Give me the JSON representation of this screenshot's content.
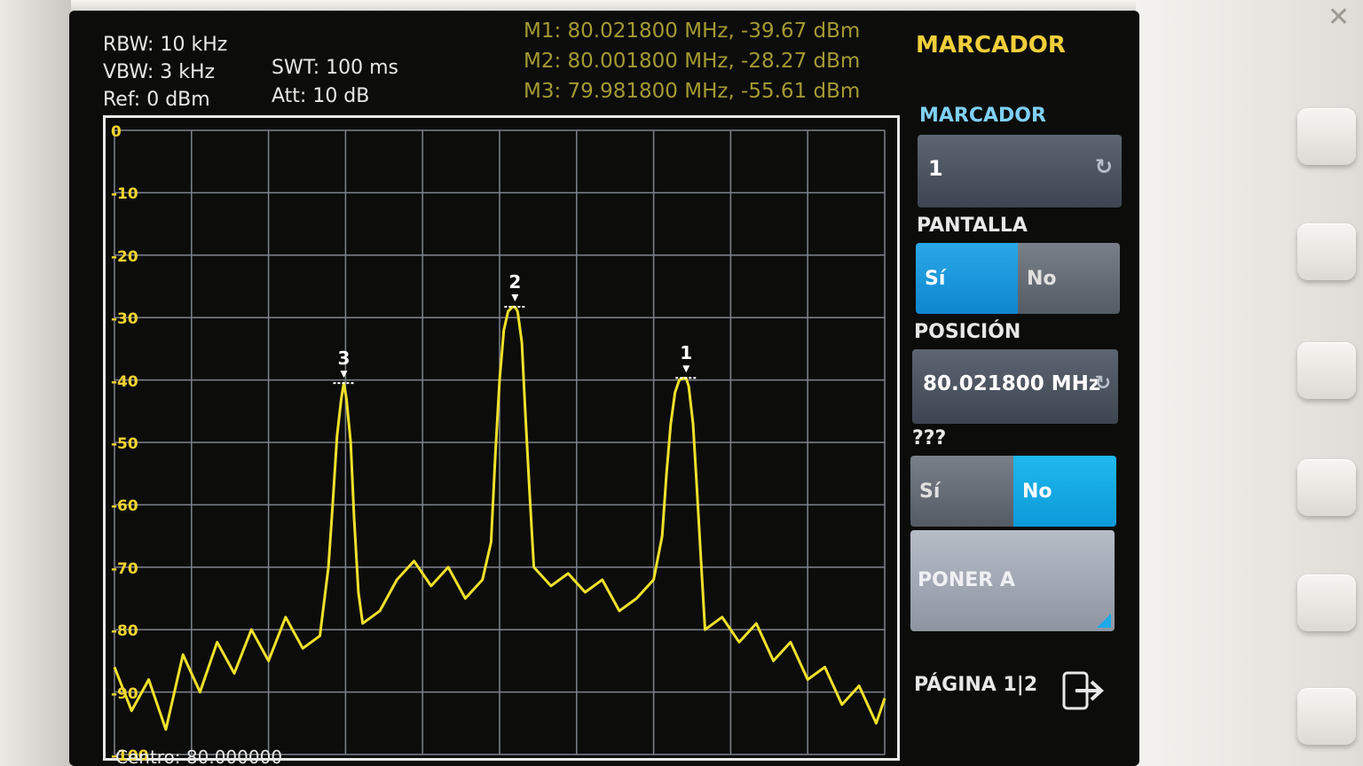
{
  "header": {
    "rbw": "RBW: 10 kHz",
    "vbw": "VBW: 3 kHz",
    "ref": "Ref: 0 dBm",
    "swt": "SWT: 100 ms",
    "att": "Att: 10 dB"
  },
  "markers": {
    "m1": "M1: 80.021800 MHz, -39.67 dBm",
    "m2": "M2: 80.001800 MHz, -28.27 dBm",
    "m3": "M3: 79.981800 MHz, -55.61 dBm"
  },
  "footer": {
    "center": "Centro: 80.000000"
  },
  "menu": {
    "title": "MARCADOR",
    "marker_label": "MARCADOR",
    "marker_value": "1",
    "display_label": "PANTALLA",
    "display_yes": "Sí",
    "display_no": "No",
    "display_selected": "Sí",
    "position_label": "POSICIÓN",
    "position_value": "80.021800 MHz",
    "unknown_label": "???",
    "unknown_yes": "Sí",
    "unknown_no": "No",
    "unknown_selected": "No",
    "set_to_label": "PONER A",
    "page_label": "PÁGINA 1|2"
  },
  "chart_data": {
    "type": "line",
    "y_ticks": [
      "0",
      "-10",
      "-20",
      "-30",
      "-40",
      "-50",
      "-60",
      "-70",
      "-80",
      "-90",
      "-100"
    ],
    "ylim": [
      -100,
      0
    ],
    "xlim": [
      79.955,
      80.045
    ],
    "grid": true,
    "marker_labels": [
      {
        "name": "1",
        "x": 80.0218,
        "y": -39.67
      },
      {
        "name": "2",
        "x": 80.0018,
        "y": -28.27
      },
      {
        "name": "3",
        "x": 79.9818,
        "y": -40.5
      }
    ],
    "series": [
      {
        "x": [
          79.955,
          79.957,
          79.959,
          79.961,
          79.963,
          79.965,
          79.967,
          79.969,
          79.971,
          79.973,
          79.975,
          79.977,
          79.979,
          79.98,
          79.9805,
          79.981,
          79.9815,
          79.9818,
          79.9821,
          79.9826,
          79.983,
          79.9835,
          79.984,
          79.986,
          79.988,
          79.99,
          79.992,
          79.994,
          79.996,
          79.998,
          79.999,
          79.9995,
          80.0,
          80.0005,
          80.001,
          80.0015,
          80.0018,
          80.0021,
          80.0026,
          80.003,
          80.0035,
          80.004,
          80.006,
          80.008,
          80.01,
          80.012,
          80.014,
          80.016,
          80.018,
          80.019,
          80.0195,
          80.02,
          80.0205,
          80.021,
          80.0215,
          80.0218,
          80.0221,
          80.0226,
          80.023,
          80.0235,
          80.024,
          80.026,
          80.028,
          80.03,
          80.032,
          80.034,
          80.036,
          80.038,
          80.04,
          80.042,
          80.044,
          80.045
        ],
        "values": [
          -86,
          -93,
          -88,
          -96,
          -84,
          -90,
          -82,
          -87,
          -80,
          -85,
          -78,
          -83,
          -81,
          -70,
          -60,
          -49,
          -43,
          -40.5,
          -43,
          -50,
          -62,
          -74,
          -79,
          -77,
          -72,
          -69,
          -73,
          -70,
          -75,
          -72,
          -66,
          -52,
          -40,
          -32,
          -29,
          -28.3,
          -28.3,
          -29,
          -34,
          -45,
          -58,
          -70,
          -73,
          -71,
          -74,
          -72,
          -77,
          -75,
          -72,
          -65,
          -55,
          -47,
          -42,
          -40,
          -39.7,
          -39.7,
          -41,
          -47,
          -56,
          -68,
          -80,
          -78,
          -82,
          -79,
          -85,
          -82,
          -88,
          -86,
          -92,
          -89,
          -95,
          -91
        ]
      }
    ]
  }
}
